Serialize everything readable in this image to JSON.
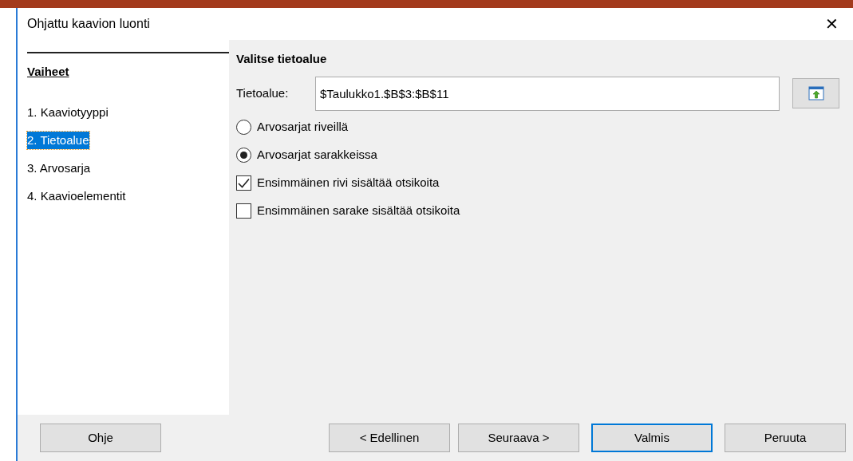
{
  "window": {
    "title": "Ohjattu kaavion luonti",
    "close": "✕"
  },
  "sidebar": {
    "heading": "Vaiheet",
    "items": [
      {
        "label": "1. Kaaviotyyppi",
        "selected": false
      },
      {
        "label": "2. Tietoalue",
        "selected": true
      },
      {
        "label": "3. Arvosarja",
        "selected": false
      },
      {
        "label": "4. Kaavioelementit",
        "selected": false
      }
    ]
  },
  "page": {
    "heading": "Valitse tietoalue",
    "range_label": "Tietoalue:",
    "range_value": "$Taulukko1.$B$3:$B$11",
    "options": [
      {
        "kind": "radio",
        "label": "Arvosarjat riveillä",
        "checked": false
      },
      {
        "kind": "radio",
        "label": "Arvosarjat sarakkeissa",
        "checked": true
      },
      {
        "kind": "checkbox",
        "label": "Ensimmäinen rivi sisältää otsikoita",
        "checked": true
      },
      {
        "kind": "checkbox",
        "label": "Ensimmäinen sarake sisältää otsikoita",
        "checked": false
      }
    ]
  },
  "buttons": [
    {
      "label": "Ohje",
      "default": false
    },
    {
      "label": "< Edellinen",
      "default": false
    },
    {
      "label": "Seuraava >",
      "default": false
    },
    {
      "label": "Valmis",
      "default": true
    },
    {
      "label": "Peruuta",
      "default": false
    }
  ]
}
